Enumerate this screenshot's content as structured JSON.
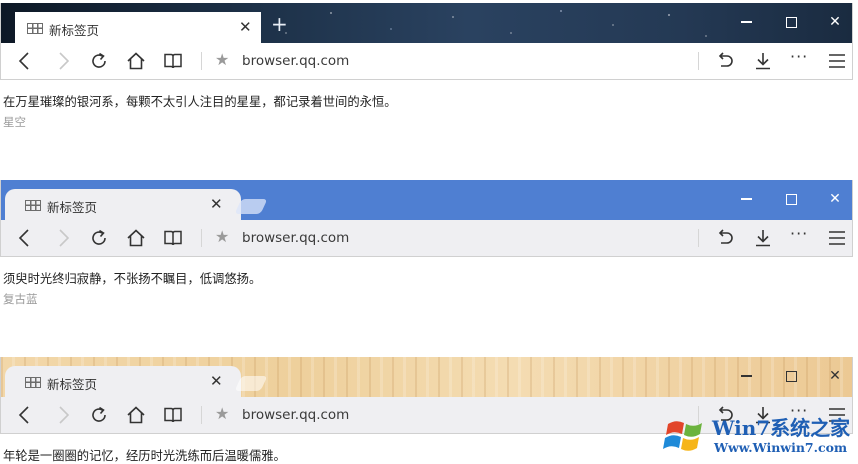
{
  "themes": [
    {
      "tab_title": "新标签页",
      "url": "browser.qq.com",
      "caption": "在万星璀璨的银河系，每颗不太引人注目的星星，都记录着世间的永恒。",
      "name": "星空"
    },
    {
      "tab_title": "新标签页",
      "url": "browser.qq.com",
      "caption": "须臾时光终归寂静，不张扬不瞩目，低调悠扬。",
      "name": "复古蓝",
      "accent": "#4f7fd2"
    },
    {
      "tab_title": "新标签页",
      "url": "browser.qq.com",
      "caption": "年轮是一圈圈的记忆，经历时光洗练而后温暖儒雅。"
    }
  ],
  "glyphs": {
    "close": "✕",
    "plus": "+",
    "star": "★",
    "more": "···"
  },
  "watermark": {
    "title": "Win7系统之家",
    "url": "Www.Winwin7.com"
  }
}
